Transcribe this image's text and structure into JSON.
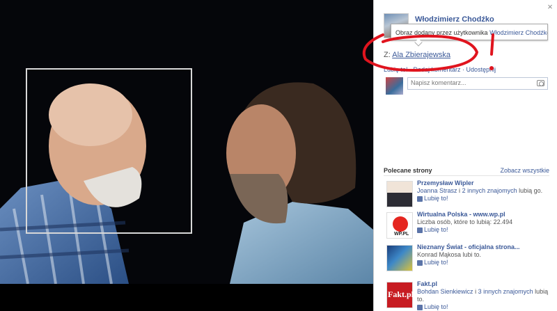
{
  "panel": {
    "owner_name": "Włodzimierz Chodźko",
    "tooltip_prefix": "Obraz dodany przez użytkownika ",
    "tooltip_owner": "Włodzimierz Chodźko",
    "from_label": "Z:",
    "from_person": "Ala Zbierajewska",
    "actions": "Lubię to! · Dodaj komentarz · Udostępnij",
    "comment_placeholder": "Napisz komentarz..."
  },
  "suggestions": {
    "title": "Polecane strony",
    "see_all": "Zobacz wszystkie",
    "like_label": "Lubię to!",
    "items": [
      {
        "name": "Przemysław Wipler",
        "info_a": "Joanna Strasz",
        "info_b": " i ",
        "info_c": "2 innych znajomych",
        "info_d": " lubią go."
      },
      {
        "name": "Wirtualna Polska - www.wp.pl",
        "info": "Liczba osób, które to lubią: 22.494"
      },
      {
        "name": "Nieznany Świat - oficjalna strona...",
        "info": "Konrad Mąkosa lubi to."
      },
      {
        "name": "Fakt.pl",
        "info_a": "Bohdan Sienkiewicz",
        "info_b": " i ",
        "info_c": "3 innych znajomych",
        "info_d": " lubią to."
      }
    ]
  },
  "icons": {
    "close": "close-icon",
    "camera": "camera-icon",
    "like": "thumbs-up-icon"
  },
  "logos": {
    "wp": "WP.PL",
    "fakt": "Fakt.pl"
  },
  "colors": {
    "link": "#3b5998",
    "annotation": "#e0141e"
  }
}
